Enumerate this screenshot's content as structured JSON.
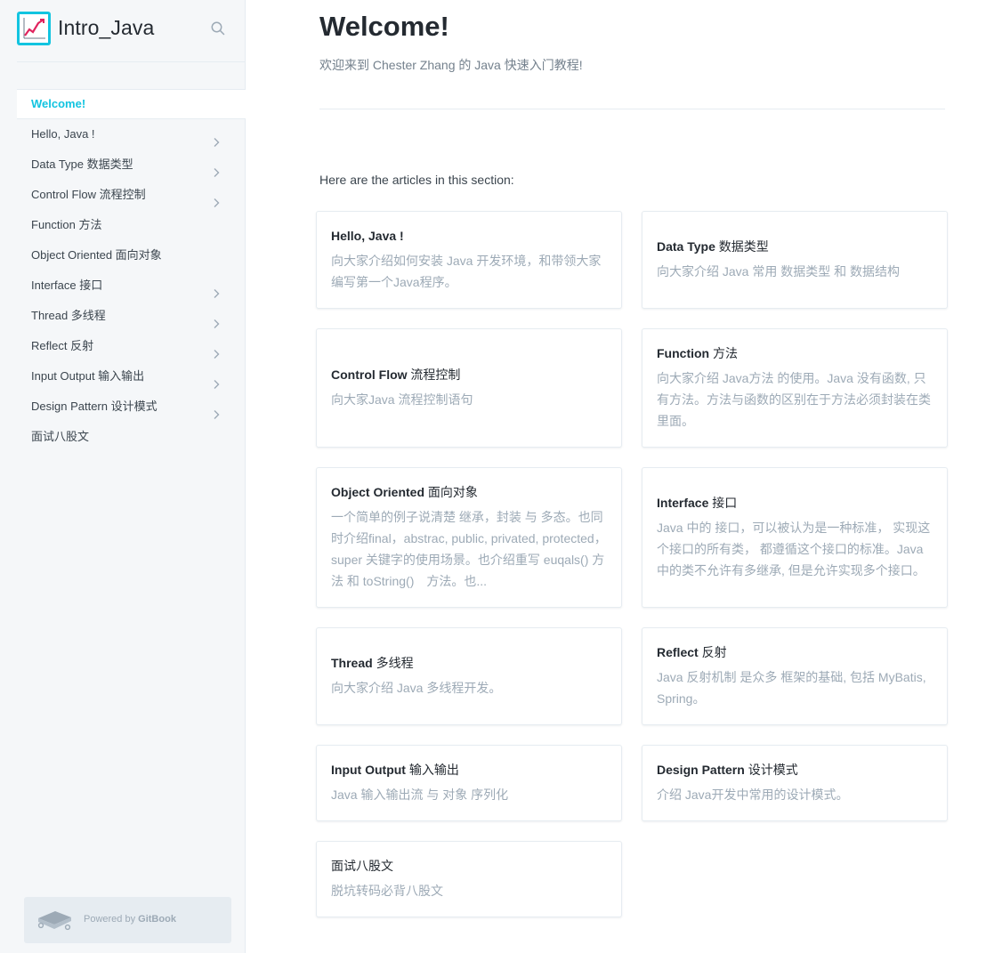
{
  "site": {
    "title": "Intro_Java",
    "logo_icon": "chart-logo-icon",
    "search_icon": "search-icon"
  },
  "sidebar": {
    "items": [
      {
        "label": "Welcome!",
        "active": true,
        "has_children": false
      },
      {
        "label": "Hello, Java !",
        "active": false,
        "has_children": true
      },
      {
        "label": "Data Type 数据类型",
        "active": false,
        "has_children": true
      },
      {
        "label": "Control Flow 流程控制",
        "active": false,
        "has_children": true
      },
      {
        "label": "Function 方法",
        "active": false,
        "has_children": false
      },
      {
        "label": "Object Oriented 面向对象",
        "active": false,
        "has_children": false
      },
      {
        "label": "Interface 接口",
        "active": false,
        "has_children": true
      },
      {
        "label": "Thread 多线程",
        "active": false,
        "has_children": true
      },
      {
        "label": "Reflect 反射",
        "active": false,
        "has_children": true
      },
      {
        "label": "Input Output 输入输出",
        "active": false,
        "has_children": true
      },
      {
        "label": "Design Pattern 设计模式",
        "active": false,
        "has_children": true
      },
      {
        "label": "面试八股文",
        "active": false,
        "has_children": false
      }
    ],
    "powered_prefix": "Powered by ",
    "powered_brand": "GitBook"
  },
  "main": {
    "title": "Welcome!",
    "description": "欢迎来到 Chester Zhang 的 Java 快速入门教程!",
    "section_intro": "Here are the articles in this section:",
    "cards": [
      {
        "title_en": "Hello, Java !",
        "title_zh": "",
        "description": "向大家介绍如何安装 Java 开发环境，和带领大家编写第一个Java程序。"
      },
      {
        "title_en": "Data Type",
        "title_zh": " 数据类型",
        "description": "向大家介绍 Java 常用 数据类型 和 数据结构"
      },
      {
        "title_en": "Control Flow",
        "title_zh": " 流程控制",
        "description": "向大家Java 流程控制语句"
      },
      {
        "title_en": "Function",
        "title_zh": " 方法",
        "description": "向大家介绍 Java方法 的使用。Java 没有函数, 只有方法。方法与函数的区别在于方法必须封装在类里面。"
      },
      {
        "title_en": "Object Oriented",
        "title_zh": " 面向对象",
        "description": "一个简单的例子说清楚 继承，封装 与 多态。也同时介绍final，abstrac, public, privated, protected，super 关键字的使用场景。也介绍重写 euqals() 方法 和 toString()　方法。也..."
      },
      {
        "title_en": "Interface",
        "title_zh": " 接口",
        "description": "Java 中的 接口，可以被认为是一种标准， 实现这个接口的所有类， 都遵循这个接口的标准。Java 中的类不允许有多继承, 但是允许实现多个接口。"
      },
      {
        "title_en": "Thread",
        "title_zh": " 多线程",
        "description": "向大家介绍 Java 多线程开发。"
      },
      {
        "title_en": "Reflect",
        "title_zh": " 反射",
        "description": "Java 反射机制 是众多 框架的基础, 包括 MyBatis, Spring。"
      },
      {
        "title_en": "Input Output",
        "title_zh": " 输入输出",
        "description": "Java 输入输出流 与 对象 序列化"
      },
      {
        "title_en": "Design Pattern",
        "title_zh": " 设计模式",
        "description": "介绍 Java开发中常用的设计模式。"
      },
      {
        "title_en": "",
        "title_zh": "面试八股文",
        "description": "脱坑转码必背八股文"
      }
    ]
  },
  "colors": {
    "accent": "#12c4e0",
    "sidebar_bg": "#f5f7f9",
    "text_primary": "#242a31",
    "text_muted": "#9daab6",
    "border": "#e6ecf1"
  }
}
